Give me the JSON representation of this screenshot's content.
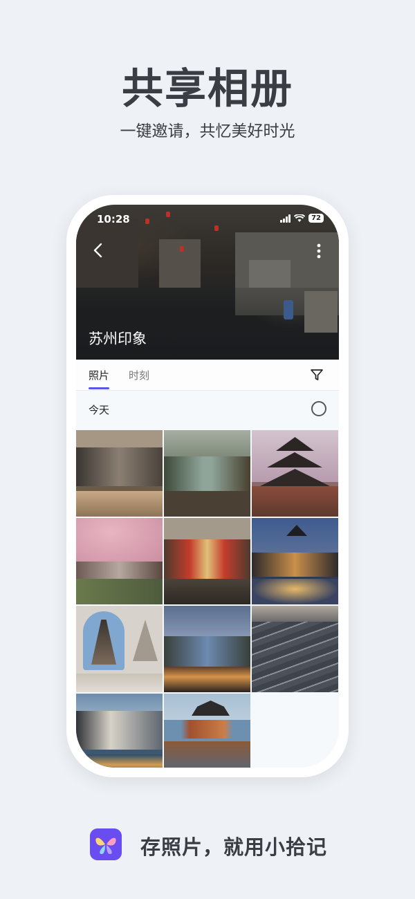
{
  "promo": {
    "headline": "共享相册",
    "subline": "一键邀请，共忆美好时光",
    "footer_text": "存照片，就用小拾记"
  },
  "status_bar": {
    "time": "10:28",
    "battery": "72"
  },
  "album": {
    "title": "苏州印象",
    "tabs": [
      {
        "label": "照片",
        "active": true
      },
      {
        "label": "时刻",
        "active": false
      }
    ],
    "section_date": "今天",
    "photo_count": 11
  },
  "icons": {
    "back": "chevron-left-icon",
    "more": "more-vertical-icon",
    "filter": "filter-icon",
    "select": "select-circle-icon",
    "brand": "butterfly-logo-icon"
  },
  "colors": {
    "accent": "#5b57e6",
    "background": "#eef1f5",
    "brand": "#6a4df0"
  }
}
